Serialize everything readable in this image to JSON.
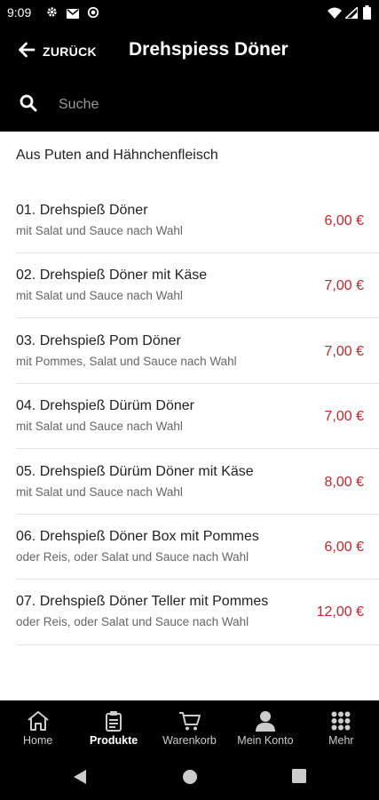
{
  "status_bar": {
    "time": "9:09"
  },
  "header": {
    "back_label": "ZURÜCK",
    "title": "Drehspiess Döner"
  },
  "search": {
    "placeholder": "Suche"
  },
  "category": {
    "title": "Aus Puten and Hähnchenfleisch"
  },
  "items": [
    {
      "name": "01. Drehspieß Döner",
      "description": "mit Salat und Sauce nach Wahl",
      "price": "6,00 €"
    },
    {
      "name": "02. Drehspieß Döner mit Käse",
      "description": "mit Salat und Sauce nach Wahl",
      "price": "7,00 €"
    },
    {
      "name": "03. Drehspieß Pom Döner",
      "description": "mit Pommes, Salat und Sauce nach Wahl",
      "price": "7,00 €"
    },
    {
      "name": "04. Drehspieß Dürüm Döner",
      "description": "mit Salat und Sauce nach Wahl",
      "price": "7,00 €"
    },
    {
      "name": "05. Drehspieß Dürüm Döner mit Käse",
      "description": "mit Salat und Sauce nach Wahl",
      "price": "8,00 €"
    },
    {
      "name": "06. Drehspieß Döner Box mit Pommes",
      "description": "oder Reis, oder Salat und Sauce nach Wahl",
      "price": "6,00 €"
    },
    {
      "name": "07. Drehspieß Döner Teller mit Pommes",
      "description": "oder Reis, oder Salat und Sauce nach Wahl",
      "price": "12,00 €"
    }
  ],
  "bottom_nav": [
    {
      "label": "Home",
      "icon": "home-icon",
      "active": false
    },
    {
      "label": "Produkte",
      "icon": "products-icon",
      "active": true
    },
    {
      "label": "Warenkorb",
      "icon": "cart-icon",
      "active": false
    },
    {
      "label": "Mein Konto",
      "icon": "account-icon",
      "active": false
    },
    {
      "label": "Mehr",
      "icon": "more-grid-icon",
      "active": false
    }
  ],
  "colors": {
    "accent_price": "#c0272d",
    "bar_background": "#000000"
  }
}
